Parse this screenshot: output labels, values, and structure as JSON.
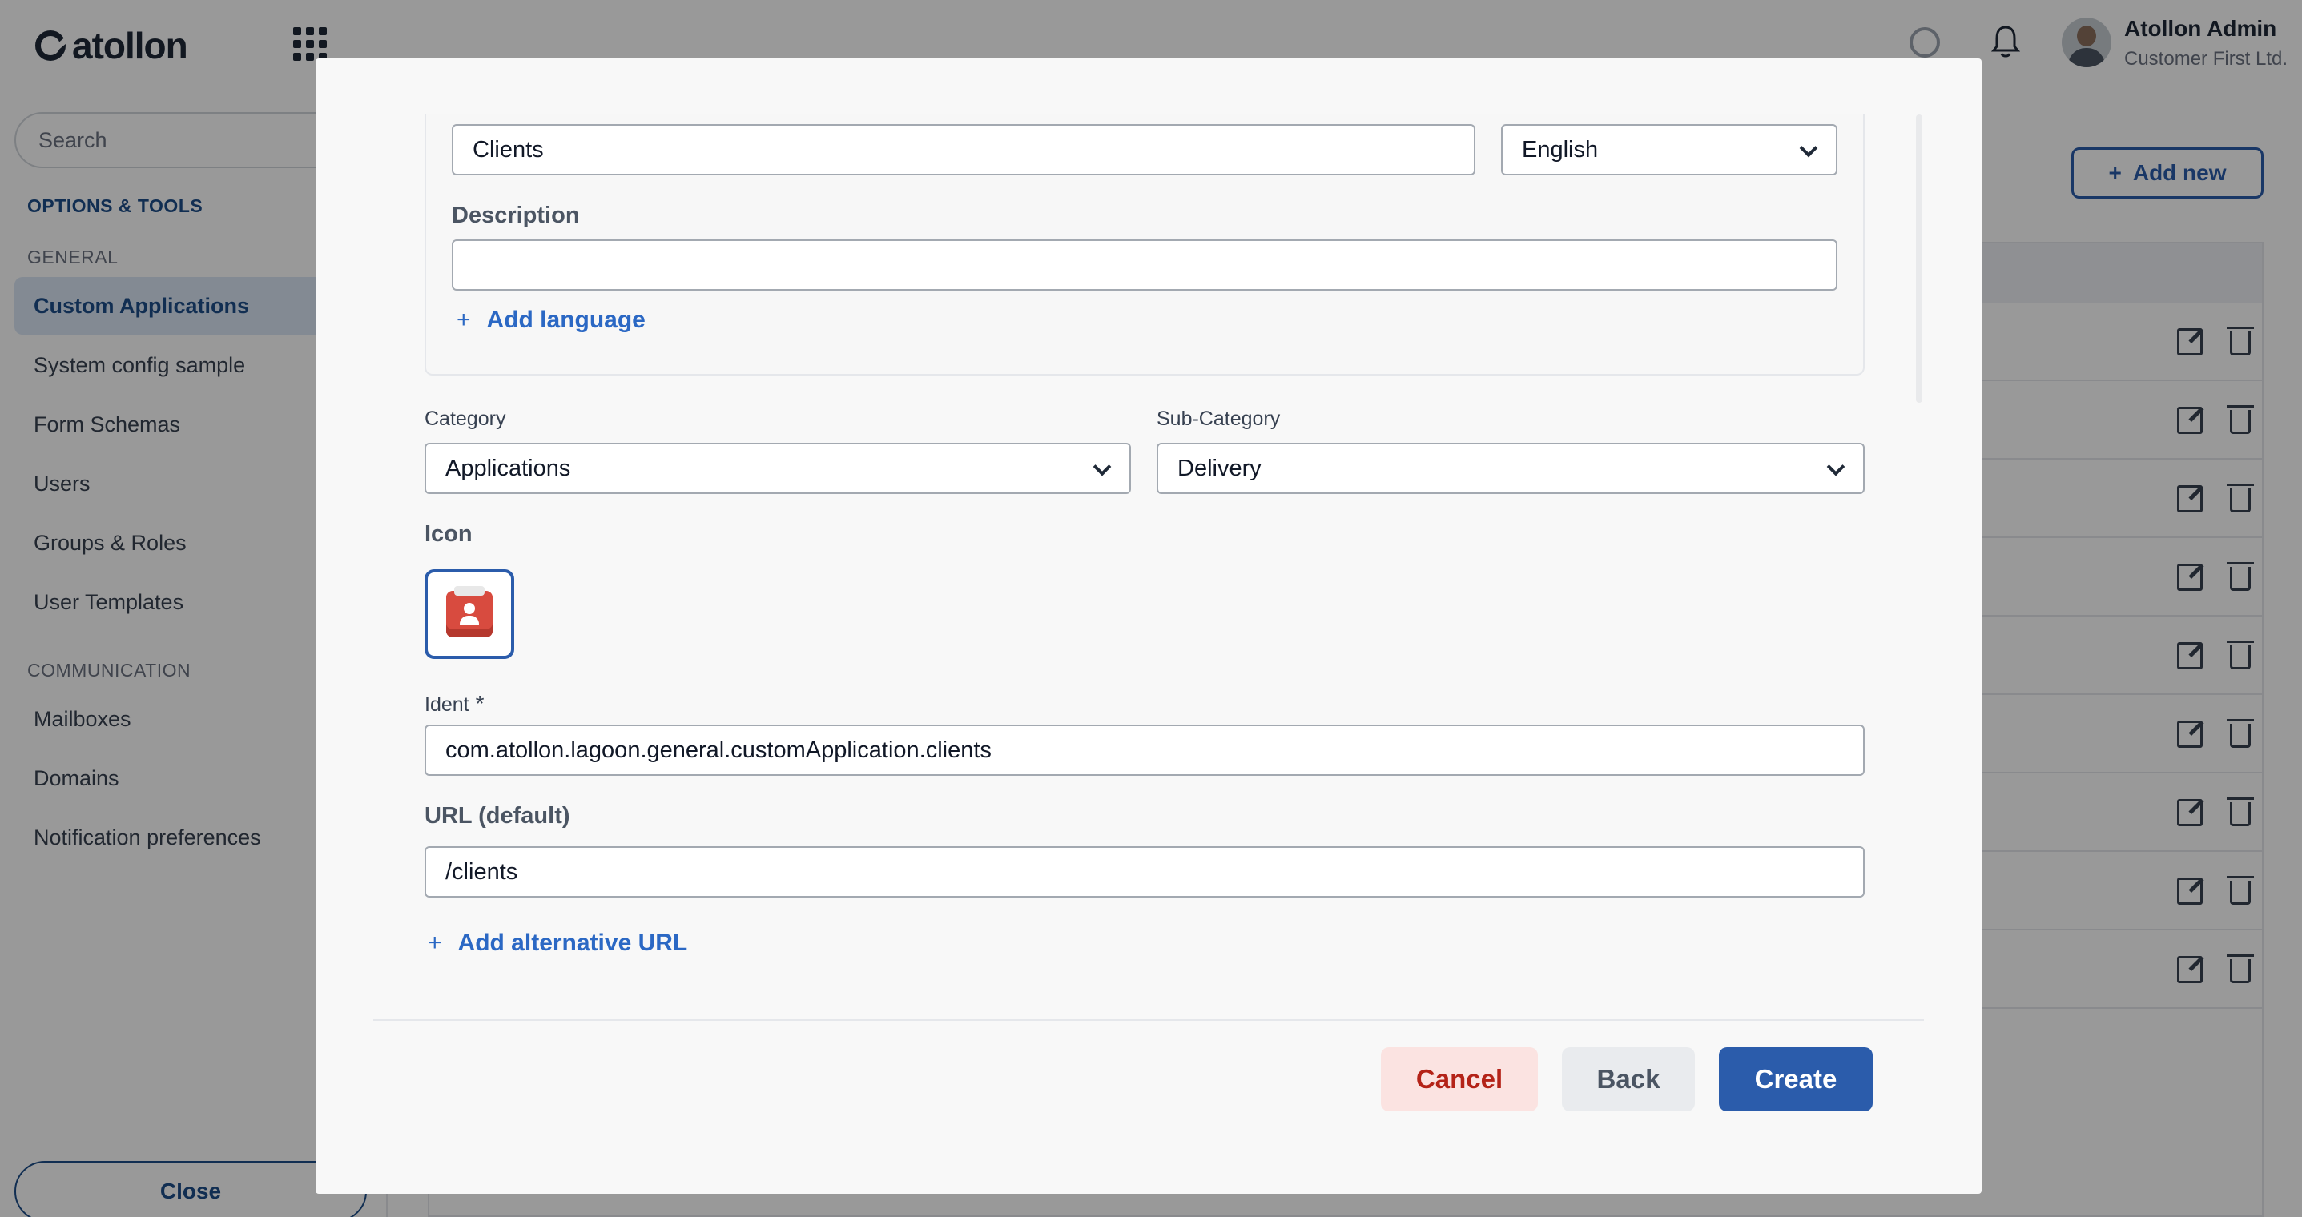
{
  "app": {
    "logo_text": "atollon",
    "user_name": "Atollon Admin",
    "user_org": "Customer First Ltd."
  },
  "sidebar": {
    "search_placeholder": "Search",
    "section_title": "OPTIONS & TOOLS",
    "groups": [
      {
        "label": "GENERAL",
        "items": [
          "Custom Applications",
          "System config sample",
          "Form Schemas",
          "Users",
          "Groups & Roles",
          "User Templates"
        ]
      },
      {
        "label": "COMMUNICATION",
        "items": [
          "Mailboxes",
          "Domains",
          "Notification preferences"
        ]
      }
    ],
    "active_item": "Custom Applications",
    "close_label": "Close"
  },
  "main": {
    "add_new_label": "Add new",
    "row_count": 9
  },
  "modal": {
    "name_value": "Clients",
    "language_value": "English",
    "description_label": "Description",
    "description_value": "",
    "add_language_label": "Add language",
    "category_label": "Category",
    "category_value": "Applications",
    "subcategory_label": "Sub-Category",
    "subcategory_value": "Delivery",
    "icon_label": "Icon",
    "ident_label": "Ident",
    "ident_required_mark": "*",
    "ident_value": "com.atollon.lagoon.general.customApplication.clients",
    "url_label": "URL (default)",
    "url_value": "/clients",
    "add_url_label": "Add alternative URL",
    "buttons": {
      "cancel": "Cancel",
      "back": "Back",
      "create": "Create"
    }
  },
  "colors": {
    "primary": "#2b5cab",
    "link": "#2b68c4",
    "cancel_bg": "#fbe3e1",
    "cancel_text": "#b42318",
    "app_icon": "#d84b3f"
  }
}
